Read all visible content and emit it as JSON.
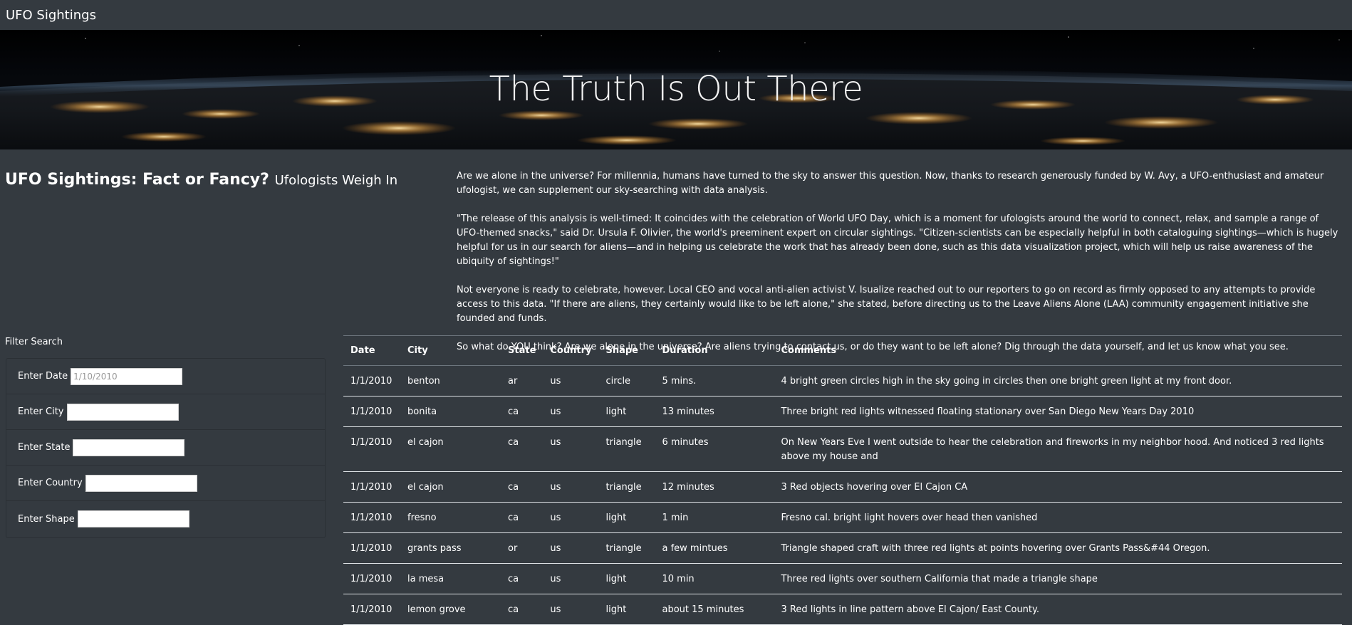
{
  "navbar": {
    "brand": "UFO Sightings"
  },
  "hero": {
    "title": "The Truth Is Out There"
  },
  "intro": {
    "heading": "UFO Sightings: Fact or Fancy?",
    "subheading": "Ufologists Weigh In"
  },
  "article": {
    "paragraphs": [
      "Are we alone in the universe? For millennia, humans have turned to the sky to answer this question. Now, thanks to research generously funded by W. Avy, a UFO-enthusiast and amateur ufologist, we can supplement our sky-searching with data analysis.",
      "\"The release of this analysis is well-timed: It coincides with the celebration of World UFO Day, which is a moment for ufologists around the world to connect, relax, and sample a range of UFO-themed snacks,\" said Dr. Ursula F. Olivier, the world's preeminent expert on circular sightings. \"Citizen-scientists can be especially helpful in both cataloguing sightings—which is hugely helpful for us in our search for aliens—and in helping us celebrate the work that has already been done, such as this data visualization project, which will help us raise awareness of the ubiquity of sightings!\"",
      "Not everyone is ready to celebrate, however. Local CEO and vocal anti-alien activist V. Isualize reached out to our reporters to go on record as firmly opposed to any attempts to provide access to this data. \"If there are aliens, they certainly would like to be left alone,\" she stated, before directing us to the Leave Aliens Alone (LAA) community engagement initiative she founded and funds.",
      "So what do YOU think? Are we alone in the universe? Are aliens trying to contact us, or do they want to be left alone? Dig through the data yourself, and let us know what you see."
    ]
  },
  "filters": {
    "title": "Filter Search",
    "date": {
      "label": "Enter Date",
      "placeholder": "1/10/2010",
      "value": ""
    },
    "city": {
      "label": "Enter City",
      "placeholder": "",
      "value": ""
    },
    "state": {
      "label": "Enter State",
      "placeholder": "",
      "value": ""
    },
    "country": {
      "label": "Enter Country",
      "placeholder": "",
      "value": ""
    },
    "shape": {
      "label": "Enter Shape",
      "placeholder": "",
      "value": ""
    }
  },
  "table": {
    "headers": [
      "Date",
      "City",
      "State",
      "Country",
      "Shape",
      "Duration",
      "Comments"
    ],
    "rows": [
      [
        "1/1/2010",
        "benton",
        "ar",
        "us",
        "circle",
        "5 mins.",
        "4 bright green circles high in the sky going in circles then one bright green light at my front door."
      ],
      [
        "1/1/2010",
        "bonita",
        "ca",
        "us",
        "light",
        "13 minutes",
        "Three bright red lights witnessed floating stationary over San Diego New Years Day 2010"
      ],
      [
        "1/1/2010",
        "el cajon",
        "ca",
        "us",
        "triangle",
        "6 minutes",
        "On New Years Eve I went outside to hear the celebration and fireworks in my neighbor hood. And noticed 3 red lights above my house and"
      ],
      [
        "1/1/2010",
        "el cajon",
        "ca",
        "us",
        "triangle",
        "12 minutes",
        "3 Red objects hovering over El Cajon CA"
      ],
      [
        "1/1/2010",
        "fresno",
        "ca",
        "us",
        "light",
        "1 min",
        "Fresno cal. bright light hovers over head then vanished"
      ],
      [
        "1/1/2010",
        "grants pass",
        "or",
        "us",
        "triangle",
        "a few mintues",
        "Triangle shaped craft with three red lights at points hovering over Grants Pass&#44 Oregon."
      ],
      [
        "1/1/2010",
        "la mesa",
        "ca",
        "us",
        "light",
        "10 min",
        "Three red lights over southern California that made a triangle shape"
      ],
      [
        "1/1/2010",
        "lemon grove",
        "ca",
        "us",
        "light",
        "about 15 minutes",
        "3 Red lights in line pattern above El Cajon/ East County."
      ]
    ]
  }
}
